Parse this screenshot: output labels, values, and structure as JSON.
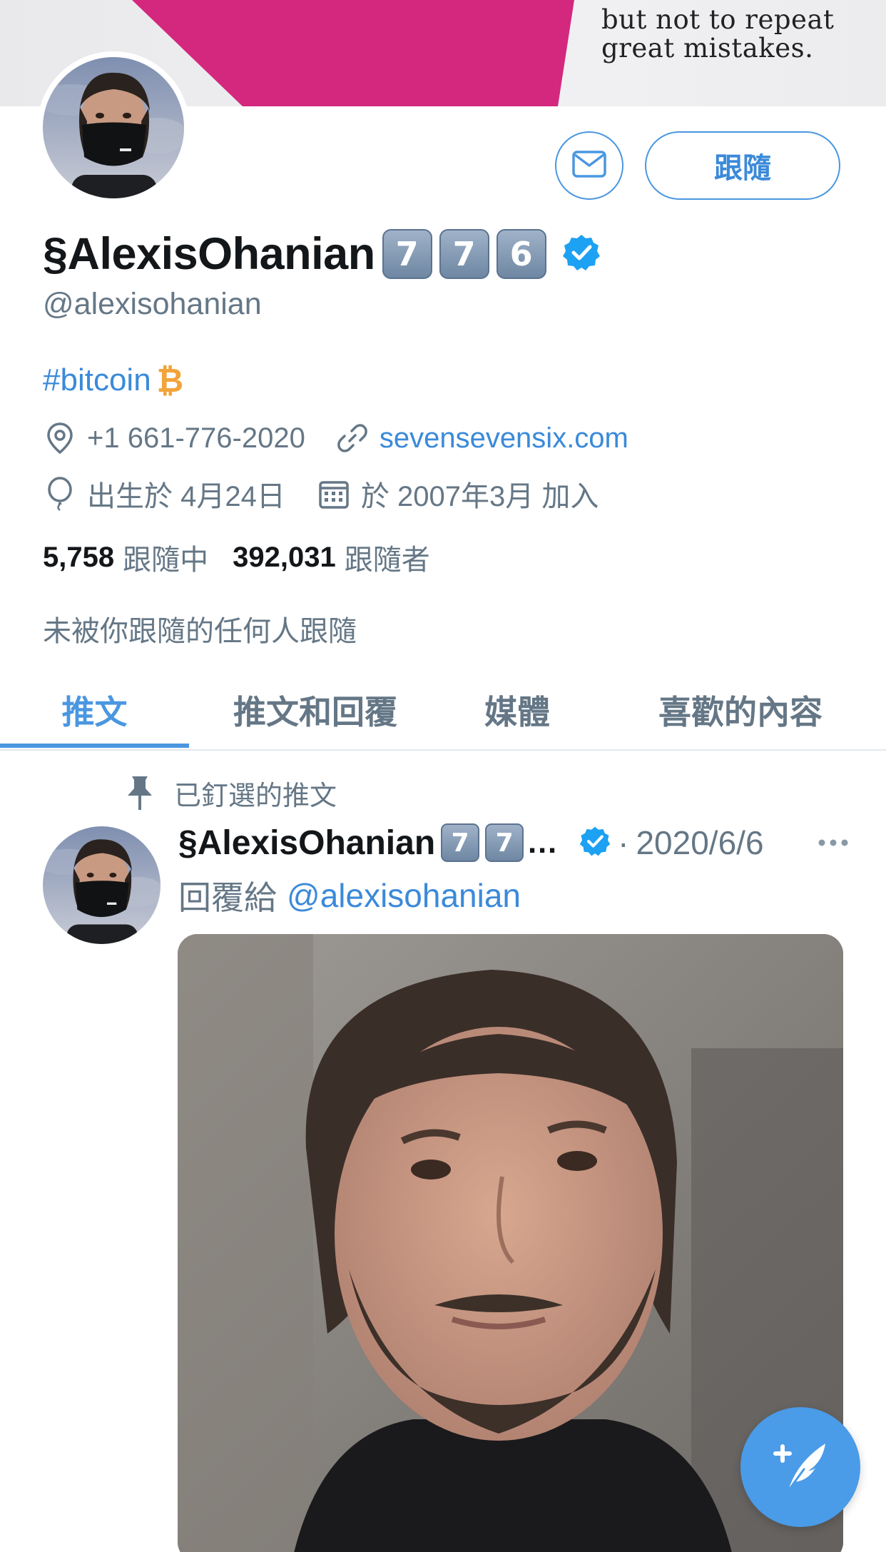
{
  "banner": {
    "text_line1": "but not to repeat",
    "text_line2": "great mistakes.",
    "accent_color": "#d4287f"
  },
  "profile": {
    "display_name": "§AlexisOhanian",
    "keycaps": [
      "7",
      "7",
      "6"
    ],
    "verified": true,
    "handle": "@alexisohanian",
    "bio_hashtag": "#bitcoin",
    "bio_symbol": "₿",
    "location": "+1 661-776-2020",
    "website": "sevensevensix.com",
    "birthday": "出生於 4月24日",
    "joined": "於 2007年3月 加入",
    "following_count": "5,758",
    "following_label": "跟隨中",
    "followers_count": "392,031",
    "followers_label": "跟隨者",
    "followed_by_text": "未被你跟隨的任何人跟隨"
  },
  "actions": {
    "follow_label": "跟隨",
    "message_icon": "envelope-icon"
  },
  "tabs": [
    {
      "label": "推文",
      "active": true
    },
    {
      "label": "推文和回覆",
      "active": false
    },
    {
      "label": "媒體",
      "active": false
    },
    {
      "label": "喜歡的內容",
      "active": false
    }
  ],
  "pinned_tweet": {
    "pinned_label": "已釘選的推文",
    "author_name": "§AlexisOhanian",
    "author_keycaps": [
      "7",
      "7"
    ],
    "truncation": "…",
    "separator": "·",
    "date": "2020/6/6",
    "reply_prefix": "回覆給",
    "reply_mention": "@alexisohanian"
  },
  "colors": {
    "accent": "#4a97e0",
    "link": "#3b8ad9",
    "secondary_text": "#657786",
    "verified": "#1da1f2",
    "bitcoin": "#f2a33a"
  }
}
